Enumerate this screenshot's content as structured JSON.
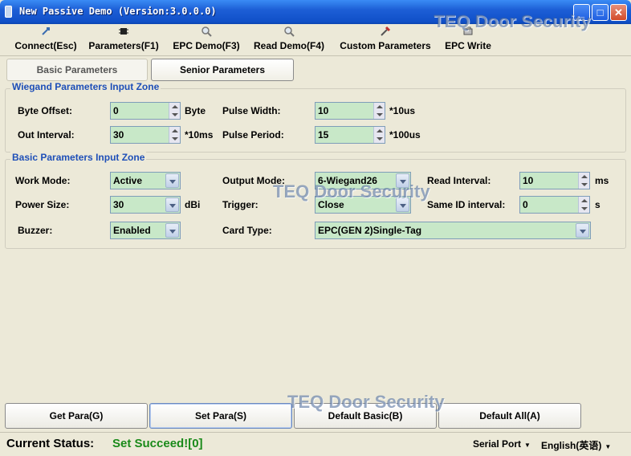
{
  "window": {
    "title": "New Passive Demo (Version:3.0.0.0)"
  },
  "watermark": "TEQ Door Security",
  "toolbar": [
    {
      "label": "Connect(Esc)",
      "icon": "connect-icon"
    },
    {
      "label": "Parameters(F1)",
      "icon": "chip-icon"
    },
    {
      "label": "EPC Demo(F3)",
      "icon": "magnifier-icon"
    },
    {
      "label": "Read Demo(F4)",
      "icon": "magnifier-icon"
    },
    {
      "label": "Custom Parameters",
      "icon": "tools-icon"
    },
    {
      "label": "EPC Write",
      "icon": "write-icon"
    }
  ],
  "tabs": [
    {
      "label": "Basic Parameters",
      "active": true
    },
    {
      "label": "Senior Parameters",
      "active": false
    }
  ],
  "wiegand": {
    "title": "Wiegand Parameters Input Zone",
    "byte_offset": {
      "label": "Byte Offset:",
      "value": "0",
      "unit": "Byte"
    },
    "pulse_width": {
      "label": "Pulse Width:",
      "value": "10",
      "unit": "*10us"
    },
    "out_interval": {
      "label": "Out Interval:",
      "value": "30",
      "unit": "*10ms"
    },
    "pulse_period": {
      "label": "Pulse Period:",
      "value": "15",
      "unit": "*100us"
    }
  },
  "basic": {
    "title": "Basic Parameters Input Zone",
    "work_mode": {
      "label": "Work Mode:",
      "value": "Active"
    },
    "output_mode": {
      "label": "Output Mode:",
      "value": "6-Wiegand26"
    },
    "read_interval": {
      "label": "Read Interval:",
      "value": "10",
      "unit": "ms"
    },
    "power_size": {
      "label": "Power Size:",
      "value": "30",
      "unit": "dBi"
    },
    "trigger": {
      "label": "Trigger:",
      "value": "Close"
    },
    "same_id": {
      "label": "Same ID interval:",
      "value": "0",
      "unit": "s"
    },
    "buzzer": {
      "label": "Buzzer:",
      "value": "Enabled"
    },
    "card_type": {
      "label": "Card Type:",
      "value": "EPC(GEN 2)Single-Tag"
    }
  },
  "buttons": {
    "get_para": "Get Para(G)",
    "set_para": "Set Para(S)",
    "default_basic": "Default Basic(B)",
    "default_all": "Default All(A)"
  },
  "status": {
    "label": "Current Status:",
    "value": "Set Succeed![0]",
    "serial_port": "Serial Port",
    "language": "English(英语)"
  },
  "colors": {
    "title_bar": "#1d5fd6",
    "group_title": "#1e4fb8",
    "field_bg": "#c8e8c8",
    "status_value": "#1a8a1a"
  }
}
